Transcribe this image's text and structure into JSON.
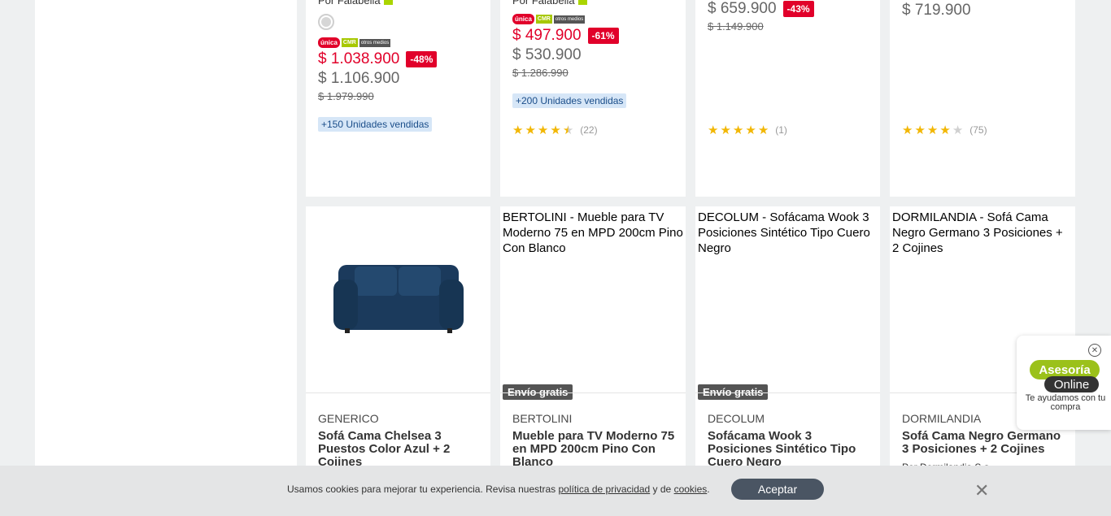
{
  "top_products": [
    {
      "seller_prefix": "Por Falabella",
      "has_swatch": true,
      "badges": [
        "única",
        "CMR",
        "otros medios"
      ],
      "price_main": "$ 1.038.900",
      "discount": "-48%",
      "price_alt": "$ 1.106.900",
      "price_old": "$ 1.979.990",
      "units": "+150 Unidades vendidas"
    },
    {
      "seller_prefix": "Por Falabella",
      "badges": [
        "única",
        "CMR",
        "otros medios"
      ],
      "price_main": "$ 497.900",
      "discount": "-61%",
      "price_alt": "$ 530.900",
      "price_old": "$ 1.286.990",
      "units": "+200 Unidades vendidas",
      "rating": 4.5,
      "reviews": "(22)"
    },
    {
      "price_alt": "$ 659.900",
      "discount": "-43%",
      "price_old": "$ 1.149.900",
      "rating": 5,
      "reviews": "(1)"
    },
    {
      "price_alt": "$ 719.900",
      "rating": 4,
      "reviews": "(75)"
    }
  ],
  "bottom_products": [
    {
      "image_alt": "",
      "brand": "GENERICO",
      "title": "Sofá Cama Chelsea 3 Puestos Color Azul + 2 Cojines"
    },
    {
      "image_alt": "BERTOLINI - Mueble para TV Moderno 75 en MPD 200cm Pino Con Blanco",
      "envio": "Envío gratis",
      "brand": "BERTOLINI",
      "title": "Mueble para TV Moderno 75 en MPD 200cm Pino Con Blanco"
    },
    {
      "image_alt": "DECOLUM - Sofácama Wook 3 Posiciones Sintético Tipo Cuero Negro",
      "envio": "Envío gratis",
      "brand": "DECOLUM",
      "title": "Sofácama Wook 3 Posiciones Sintético Tipo Cuero Negro"
    },
    {
      "image_alt": "DORMILANDIA - Sofá Cama Negro Germano 3 Posiciones + 2 Cojines",
      "brand": "DORMILANDIA",
      "title": "Sofá Cama Negro Germano 3 Posiciones + 2 Cojines",
      "seller_prefix": "Por Dormilandia S.a."
    }
  ],
  "chat": {
    "line1": "Asesoría",
    "line2": "Online",
    "help": "Te ayudamos con tu compra"
  },
  "cookies": {
    "text_before": "Usamos cookies para mejorar tu experiencia. Revisa nuestras ",
    "privacy_link": "política de privacidad",
    "text_middle": " y de ",
    "cookies_link": "cookies",
    "text_after": ".",
    "accept_label": "Aceptar"
  },
  "colors": {
    "sale_red": "#e1002a",
    "accent_green": "#aad500",
    "accept_button": "#4a5563"
  }
}
